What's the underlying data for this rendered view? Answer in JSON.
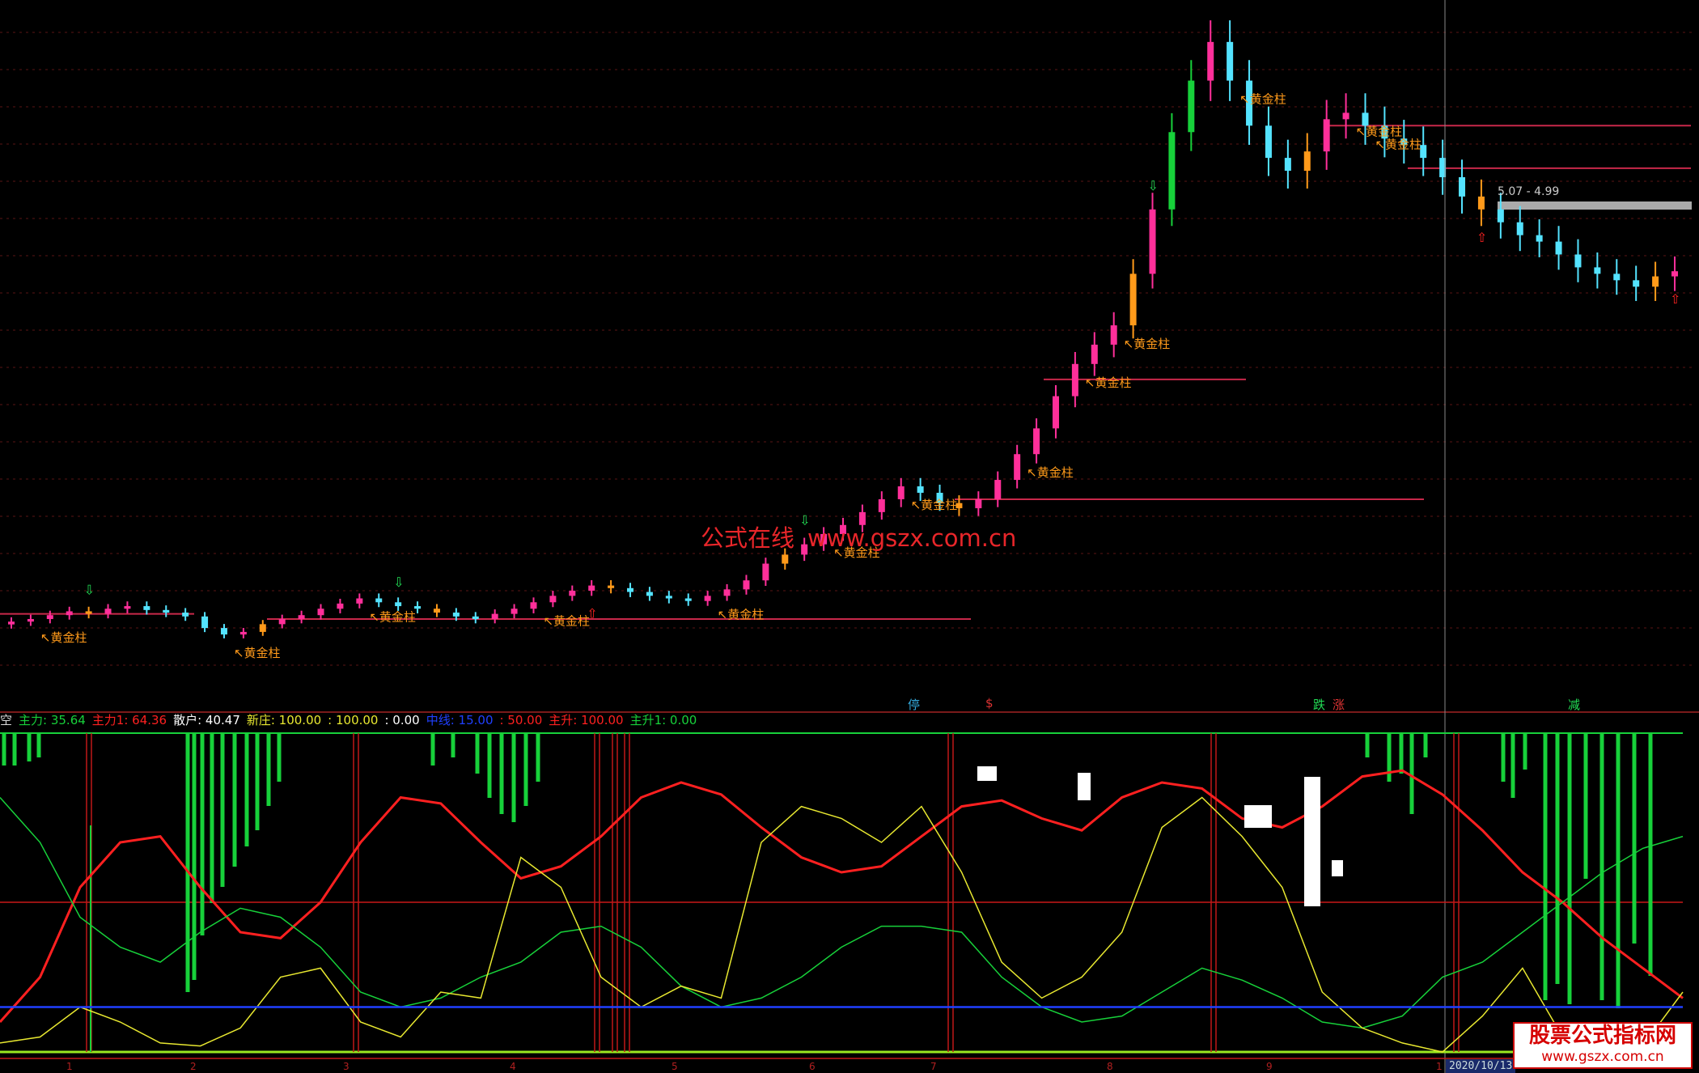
{
  "chart_data": [
    {
      "type": "candlestick",
      "title": "",
      "colors": {
        "up": "#ff2f9a",
        "down": "#54e3ff",
        "gold": "#ff9a1a",
        "green": "#17d13a",
        "ref": "#c8284a"
      },
      "price_label": "5.07 - 4.99",
      "watermark": [
        "公式在线",
        "www.gszx.com.cn"
      ],
      "annotation_text": "黄金柱",
      "marker_labels": [
        "停",
        "$",
        "跌",
        "涨",
        "减"
      ],
      "close_series": [
        1.1,
        1.12,
        1.15,
        1.18,
        1.16,
        1.2,
        1.22,
        1.19,
        1.17,
        1.14,
        1.05,
        1.0,
        1.02,
        1.08,
        1.12,
        1.15,
        1.2,
        1.24,
        1.28,
        1.25,
        1.22,
        1.2,
        1.17,
        1.14,
        1.12,
        1.16,
        1.2,
        1.25,
        1.3,
        1.34,
        1.38,
        1.36,
        1.33,
        1.3,
        1.28,
        1.26,
        1.3,
        1.35,
        1.42,
        1.55,
        1.62,
        1.7,
        1.78,
        1.85,
        1.95,
        2.05,
        2.15,
        2.1,
        2.02,
        1.98,
        2.05,
        2.2,
        2.4,
        2.6,
        2.85,
        3.1,
        3.25,
        3.4,
        3.8,
        4.3,
        4.9,
        5.3,
        5.6,
        5.3,
        4.95,
        4.7,
        4.6,
        4.75,
        5.0,
        5.05,
        4.95,
        4.85,
        4.8,
        4.7,
        4.55,
        4.4,
        4.3,
        4.2,
        4.1,
        4.05,
        3.95,
        3.85,
        3.8,
        3.75,
        3.7,
        3.78,
        3.82
      ]
    },
    {
      "type": "line",
      "title": "",
      "legend": [
        {
          "label": "空",
          "color": "#dddddd"
        },
        {
          "label": "主力: 35.64",
          "color": "#17d13a"
        },
        {
          "label": "主力1: 64.36",
          "color": "#ff2020"
        },
        {
          "label": "散户: 40.47",
          "color": "#ffffff"
        },
        {
          "label": "新庄: 100.00",
          "color": "#e8e830"
        },
        {
          "label": ": 100.00",
          "color": "#e8e830"
        },
        {
          "label": ": 0.00",
          "color": "#ffffff"
        },
        {
          "label": "中线: 15.00",
          "color": "#2040ff"
        },
        {
          "label": ": 50.00",
          "color": "#ff2020"
        },
        {
          "label": "主升: 100.00",
          "color": "#ff2020"
        },
        {
          "label": "主升1: 0.00",
          "color": "#17d13a"
        }
      ],
      "ylim": [
        0,
        100
      ],
      "x_ticks": [
        "1",
        "2",
        "3",
        "4",
        "5",
        "6",
        "7",
        "8",
        "9",
        "1"
      ],
      "date_label": "2020/10/13",
      "series": [
        {
          "name": "主力1",
          "color": "#ff2020",
          "values": [
            10,
            25,
            55,
            70,
            72,
            55,
            40,
            38,
            50,
            70,
            85,
            83,
            70,
            58,
            62,
            72,
            85,
            90,
            86,
            75,
            65,
            60,
            62,
            72,
            82,
            84,
            78,
            74,
            85,
            90,
            88,
            78,
            75,
            82,
            92,
            94,
            86,
            74,
            60,
            50,
            38,
            28,
            18
          ]
        },
        {
          "name": "主力",
          "color": "#17d13a",
          "values": [
            85,
            70,
            45,
            35,
            30,
            40,
            48,
            45,
            35,
            20,
            15,
            18,
            25,
            30,
            40,
            42,
            35,
            22,
            15,
            18,
            25,
            35,
            42,
            42,
            40,
            25,
            15,
            10,
            12,
            20,
            28,
            24,
            18,
            10,
            8,
            12,
            25,
            30,
            40,
            50,
            60,
            68,
            72
          ]
        },
        {
          "name": "散户",
          "color": "#e8e830",
          "values": [
            3,
            5,
            15,
            10,
            3,
            2,
            8,
            25,
            28,
            10,
            5,
            20,
            18,
            65,
            55,
            25,
            15,
            22,
            18,
            70,
            82,
            78,
            70,
            82,
            60,
            30,
            18,
            25,
            40,
            75,
            85,
            72,
            55,
            20,
            8,
            3,
            0,
            12,
            28,
            5,
            0,
            2,
            20
          ]
        },
        {
          "name": "中线",
          "color": "#2040ff",
          "values": [
            15,
            15,
            15,
            15,
            15,
            15,
            15,
            15,
            15,
            15,
            15,
            15,
            15,
            15,
            15,
            15,
            15,
            15,
            15,
            15,
            15,
            15,
            15,
            15,
            15,
            15,
            15,
            15,
            15,
            15,
            15,
            15,
            15,
            15,
            15,
            15,
            15,
            15,
            15,
            15,
            15,
            15,
            15
          ]
        }
      ]
    }
  ]
}
